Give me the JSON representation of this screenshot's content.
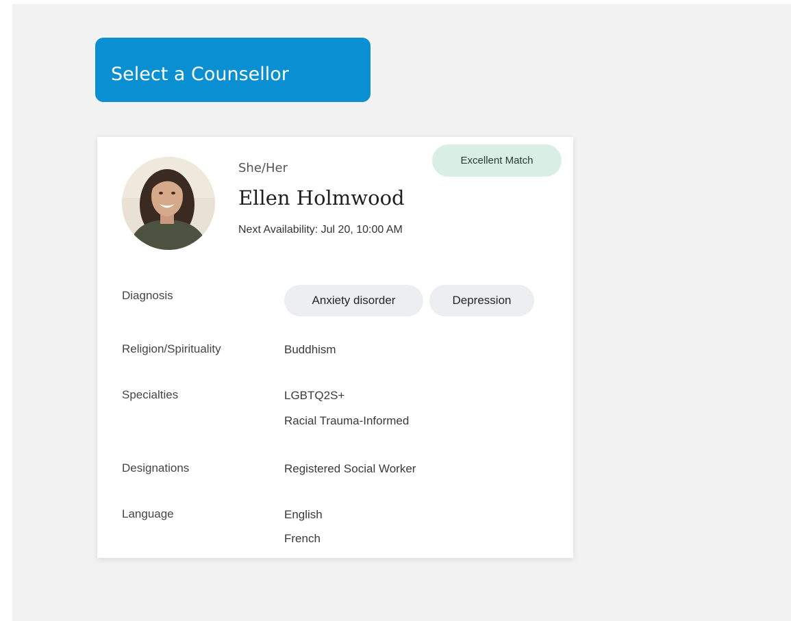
{
  "header": {
    "title": "Select a Counsellor"
  },
  "counsellor": {
    "pronouns": "She/Her",
    "name": "Ellen Holmwood",
    "availability": "Next Availability: Jul 20, 10:00 AM",
    "match_badge": "Excellent Match",
    "avatar_icon": "counsellor-photo"
  },
  "details": {
    "diagnosis": {
      "label": "Diagnosis",
      "chips": [
        "Anxiety disorder",
        "Depression"
      ]
    },
    "religion": {
      "label": "Religion/Spirituality",
      "values": [
        "Buddhism"
      ]
    },
    "specialties": {
      "label": "Specialties",
      "values": [
        "LGBTQ2S+",
        "Racial Trauma-Informed"
      ]
    },
    "designations": {
      "label": "Designations",
      "values": [
        "Registered Social Worker"
      ]
    },
    "language": {
      "label": "Language",
      "values": [
        "English",
        "French"
      ]
    }
  },
  "colors": {
    "banner": "#0b8fd3",
    "badge_bg": "#d9efe6",
    "chip_bg": "#eceef2",
    "page_bg": "#f2f2f2"
  }
}
